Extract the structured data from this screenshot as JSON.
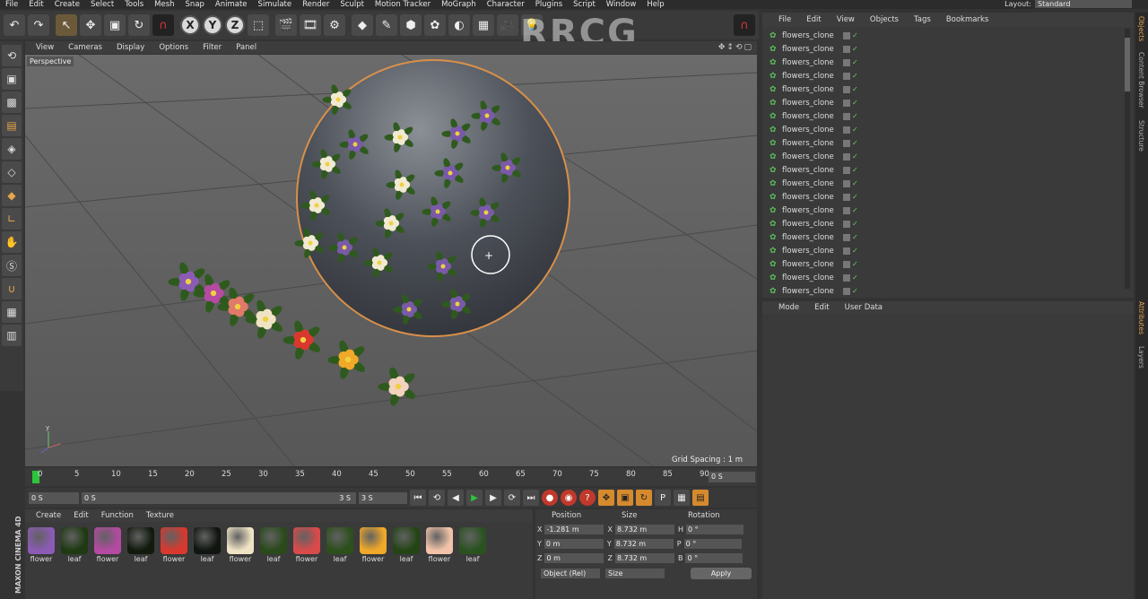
{
  "menubar": [
    "File",
    "Edit",
    "Create",
    "Select",
    "Tools",
    "Mesh",
    "Snap",
    "Animate",
    "Simulate",
    "Render",
    "Sculpt",
    "Motion Tracker",
    "MoGraph",
    "Character",
    "Plugins",
    "Script",
    "Window",
    "Help"
  ],
  "layout": {
    "label": "Layout:",
    "value": "Standard"
  },
  "watermark": "RRCG",
  "viewport": {
    "menu": [
      "View",
      "Cameras",
      "Display",
      "Options",
      "Filter",
      "Panel"
    ],
    "label": "Perspective",
    "grid_spacing": "Grid Spacing : 1 m"
  },
  "timeline": {
    "ticks": [
      "0",
      "5",
      "10",
      "15",
      "20",
      "25",
      "30",
      "35",
      "40",
      "45",
      "50",
      "55",
      "60",
      "65",
      "70",
      "75",
      "80",
      "85",
      "90"
    ],
    "end_field": "0 S"
  },
  "transport": {
    "start": "0 S",
    "range_start": "0 S",
    "range_end": "3 S",
    "end": "3 S"
  },
  "materials": {
    "menu": [
      "Create",
      "Edit",
      "Function",
      "Texture"
    ],
    "items": [
      {
        "label": "flower",
        "color": "#8b5bb5"
      },
      {
        "label": "leaf",
        "color": "#1f3a12"
      },
      {
        "label": "flower",
        "color": "#b44aa2"
      },
      {
        "label": "leaf",
        "color": "#121a0e"
      },
      {
        "label": "flower",
        "color": "#d9382e"
      },
      {
        "label": "leaf",
        "color": "#101510"
      },
      {
        "label": "flower",
        "color": "#efe3c4"
      },
      {
        "label": "leaf",
        "color": "#2a4a1a"
      },
      {
        "label": "flower",
        "color": "#d94a4a"
      },
      {
        "label": "leaf",
        "color": "#2c4f1c"
      },
      {
        "label": "flower",
        "color": "#f0a928"
      },
      {
        "label": "leaf",
        "color": "#234515"
      },
      {
        "label": "flower",
        "color": "#f2c3a8"
      },
      {
        "label": "leaf",
        "color": "#2a5220"
      }
    ]
  },
  "coords": {
    "headers": [
      "Position",
      "Size",
      "Rotation"
    ],
    "rows": [
      {
        "axis": "X",
        "pos": "-1.281 m",
        "size_axis": "X",
        "size": "8.732 m",
        "rot_axis": "H",
        "rot": "0 °"
      },
      {
        "axis": "Y",
        "pos": "0 m",
        "size_axis": "Y",
        "size": "8.732 m",
        "rot_axis": "P",
        "rot": "0 °"
      },
      {
        "axis": "Z",
        "pos": "0 m",
        "size_axis": "Z",
        "size": "8.732 m",
        "rot_axis": "B",
        "rot": "0 °"
      }
    ],
    "mode": "Object (Rel)",
    "size_mode": "Size",
    "apply": "Apply"
  },
  "brand": "MAXON CINEMA 4D",
  "object_manager": {
    "menu": [
      "File",
      "Edit",
      "View",
      "Objects",
      "Tags",
      "Bookmarks"
    ],
    "objects": [
      "flowers_clone",
      "flowers_clone",
      "flowers_clone",
      "flowers_clone",
      "flowers_clone",
      "flowers_clone",
      "flowers_clone",
      "flowers_clone",
      "flowers_clone",
      "flowers_clone",
      "flowers_clone",
      "flowers_clone",
      "flowers_clone",
      "flowers_clone",
      "flowers_clone",
      "flowers_clone",
      "flowers_clone",
      "flowers_clone",
      "flowers_clone",
      "flowers_clone"
    ]
  },
  "attribute_manager": {
    "menu": [
      "Mode",
      "Edit",
      "User Data"
    ]
  },
  "side_tabs": [
    "Objects",
    "Content Browser",
    "Structure",
    "Attributes",
    "Layers"
  ],
  "scene": {
    "sphere_flowers_purple": "#7a5aa8",
    "sphere_flowers_white": "#f1ead2",
    "leaf_green": "#2f5a1e"
  }
}
